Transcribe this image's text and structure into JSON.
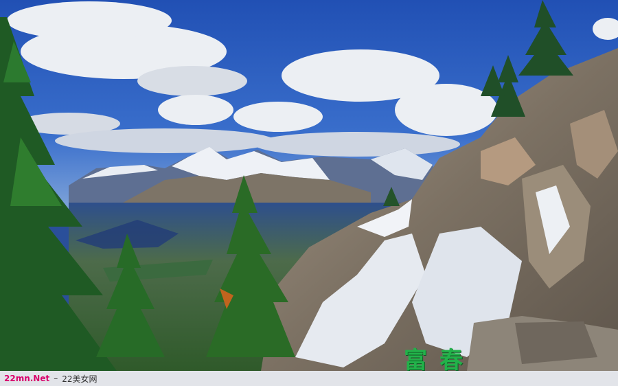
{
  "watermark": {
    "calligraphy_text": "富春",
    "footer_site": "22mn.Net",
    "footer_separator": "–",
    "footer_name": "22美女网"
  },
  "colors": {
    "sky": "#2a57b8",
    "cloud": "#eceff3",
    "snow": "#f3f5f8",
    "rock": "#8c8378",
    "tree": "#1f5a24",
    "footer_site": "#d8006b",
    "calligraphy": "#22b24a"
  }
}
